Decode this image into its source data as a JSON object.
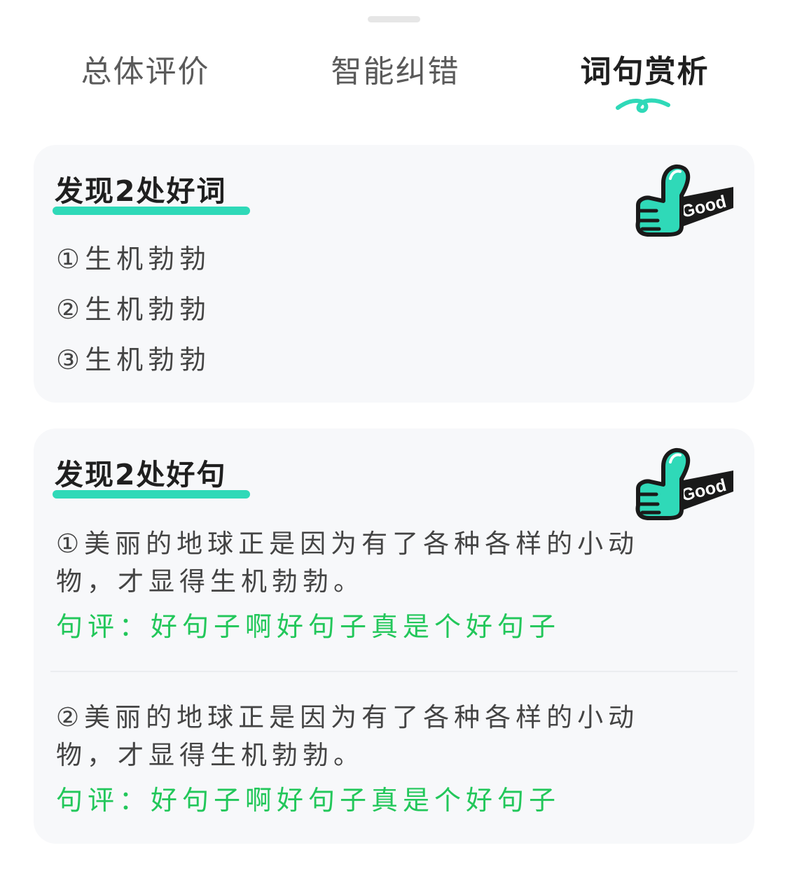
{
  "tabs": [
    {
      "label": "总体评价",
      "active": false
    },
    {
      "label": "智能纠错",
      "active": false
    },
    {
      "label": "词句赏析",
      "active": true
    }
  ],
  "badge_text": "Good",
  "accent_color": "#2fd9b8",
  "comment_color": "#22c75a",
  "good_words": {
    "title": "发现2处好词",
    "items": [
      "①生机勃勃",
      "②生机勃勃",
      "③生机勃勃"
    ]
  },
  "good_sentences": {
    "title": "发现2处好句",
    "items": [
      {
        "text": "①美丽的地球正是因为有了各种各样的小动物，才显得生机勃勃。",
        "comment": "句评：好句子啊好句子真是个好句子"
      },
      {
        "text": "②美丽的地球正是因为有了各种各样的小动物，才显得生机勃勃。",
        "comment": "句评：好句子啊好句子真是个好句子"
      }
    ]
  }
}
